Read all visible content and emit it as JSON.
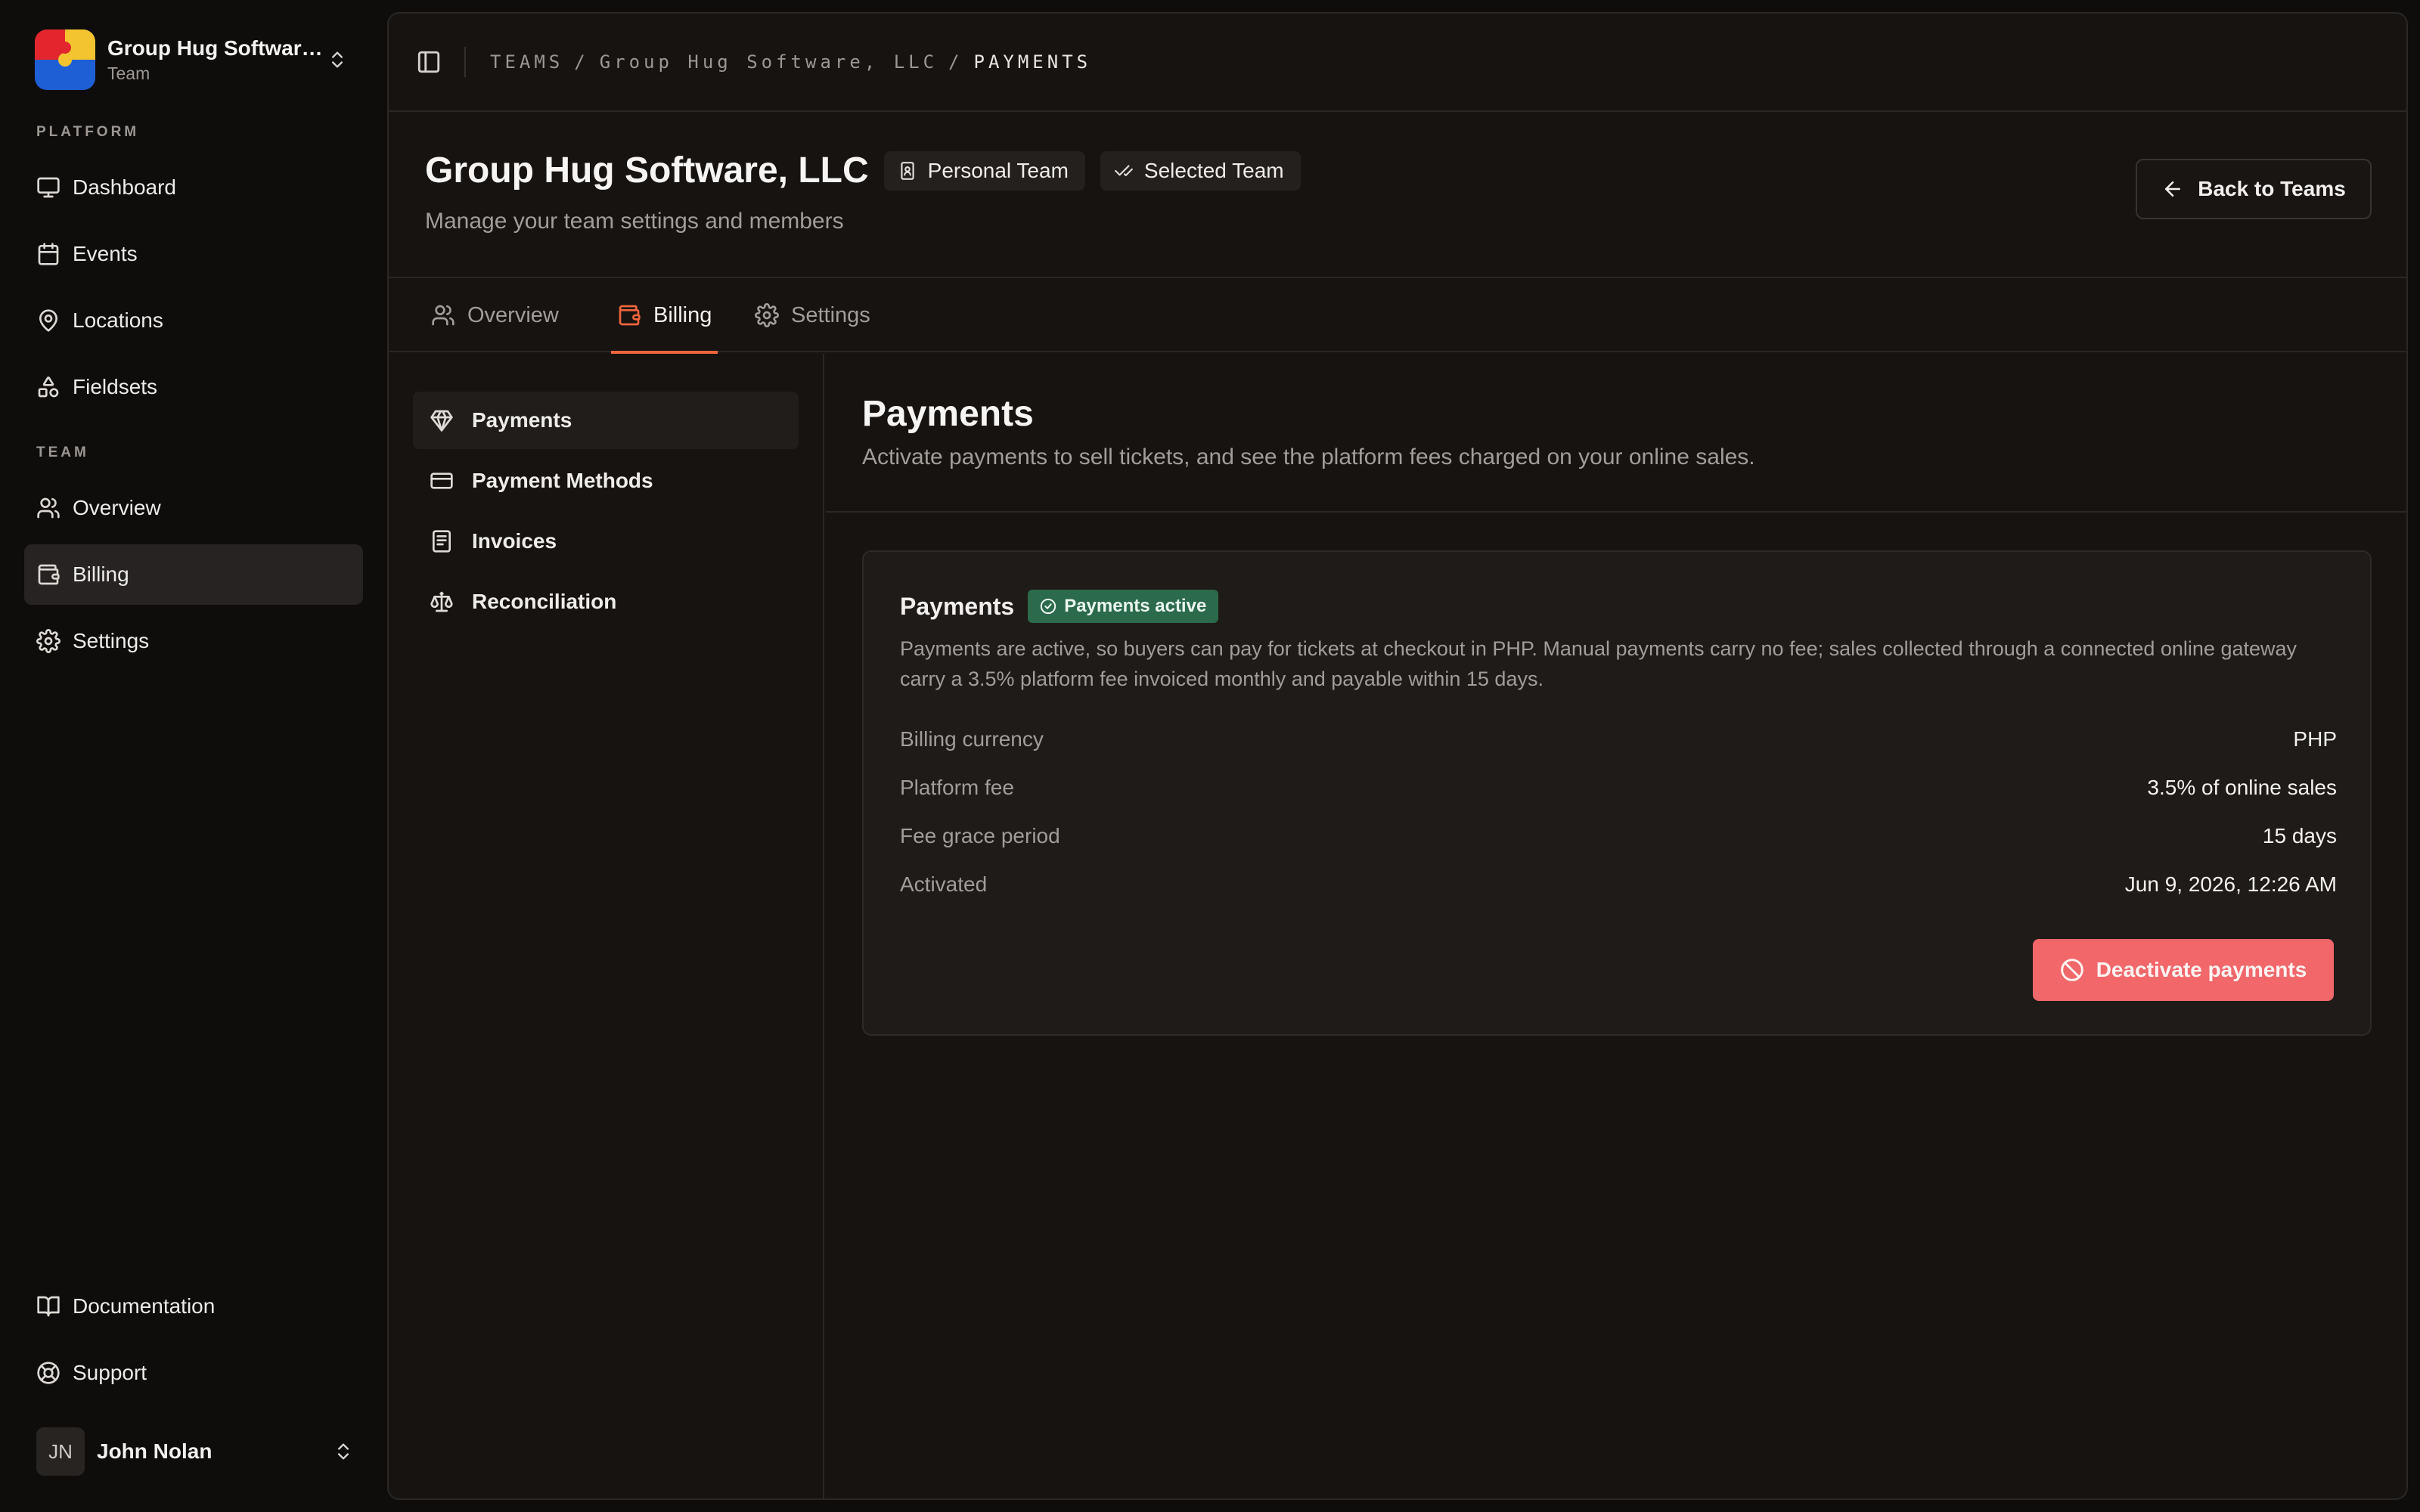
{
  "sidebar": {
    "team": {
      "name": "Group Hug Software...",
      "subtitle": "Team"
    },
    "platform_label": "PLATFORM",
    "platform_items": [
      {
        "label": "Dashboard",
        "icon": "monitor-icon"
      },
      {
        "label": "Events",
        "icon": "calendar-icon"
      },
      {
        "label": "Locations",
        "icon": "map-pin-icon"
      },
      {
        "label": "Fieldsets",
        "icon": "shapes-icon"
      }
    ],
    "team_label": "TEAM",
    "team_items": [
      {
        "label": "Overview",
        "icon": "users-icon"
      },
      {
        "label": "Billing",
        "icon": "wallet-icon",
        "active": true
      },
      {
        "label": "Settings",
        "icon": "gear-icon"
      }
    ],
    "footer_items": [
      {
        "label": "Documentation",
        "icon": "book-open-icon"
      },
      {
        "label": "Support",
        "icon": "life-buoy-icon"
      }
    ],
    "user": {
      "initials": "JN",
      "name": "John Nolan"
    }
  },
  "topbar": {
    "breadcrumb": [
      "TEAMS",
      "/",
      "Group Hug Software, LLC",
      "/",
      "PAYMENTS"
    ]
  },
  "header": {
    "title": "Group Hug Software, LLC",
    "chips": [
      "Personal Team",
      "Selected Team"
    ],
    "subtitle": "Manage your team settings and members",
    "back_label": "Back to Teams"
  },
  "tabs": [
    {
      "label": "Overview"
    },
    {
      "label": "Billing",
      "active": true
    },
    {
      "label": "Settings"
    }
  ],
  "subnav": [
    {
      "label": "Payments",
      "active": true
    },
    {
      "label": "Payment Methods"
    },
    {
      "label": "Invoices"
    },
    {
      "label": "Reconciliation"
    }
  ],
  "content": {
    "title": "Payments",
    "subtitle": "Activate payments to sell tickets, and see the platform fees charged on your online sales.",
    "card": {
      "title": "Payments",
      "badge": "Payments active",
      "description": "Payments are active, so buyers can pay for tickets at checkout in PHP. Manual payments carry no fee; sales collected through a connected online gateway carry a 3.5% platform fee invoiced monthly and payable within 15 days.",
      "rows": [
        {
          "label": "Billing currency",
          "value": "PHP"
        },
        {
          "label": "Platform fee",
          "value": "3.5% of online sales"
        },
        {
          "label": "Fee grace period",
          "value": "15 days"
        },
        {
          "label": "Activated",
          "value": "Jun 9, 2026, 12:26 AM"
        }
      ],
      "deactivate_label": "Deactivate payments"
    }
  },
  "colors": {
    "accent": "#f0653d",
    "success_badge": "#2b6a4a",
    "danger_button": "#f1676a"
  }
}
